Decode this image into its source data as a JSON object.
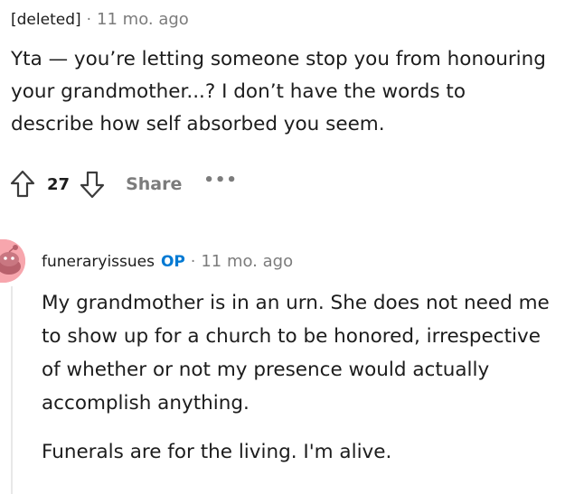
{
  "comment": {
    "author": "[deleted]",
    "separator": "·",
    "time": "11 mo. ago",
    "body": "Yta — you’re letting someone stop you from honouring your grandmother...? I don’t have the words to describe how self absorbed you seem.",
    "actions": {
      "score": "27",
      "share_label": "Share",
      "more_label": "•••"
    }
  },
  "reply": {
    "author": "funeraryissues",
    "op_badge": "OP",
    "separator": "·",
    "time": "11 mo. ago",
    "paragraphs": [
      "My grandmother is in an urn. She does not need me to show up for a church to be honored, irrespective of whether or not my presence would actually accomplish anything.",
      "Funerals are for the living. I'm alive."
    ]
  },
  "colors": {
    "text": "#1c1c1c",
    "muted": "#7c7c7c",
    "op_badge": "#0079d3",
    "avatar": "#f7a6ad",
    "thread_line": "#e8e8e8"
  },
  "icons": {
    "upvote": "upvote-arrow-icon",
    "downvote": "downvote-arrow-icon",
    "avatar": "snoo-avatar-icon"
  }
}
